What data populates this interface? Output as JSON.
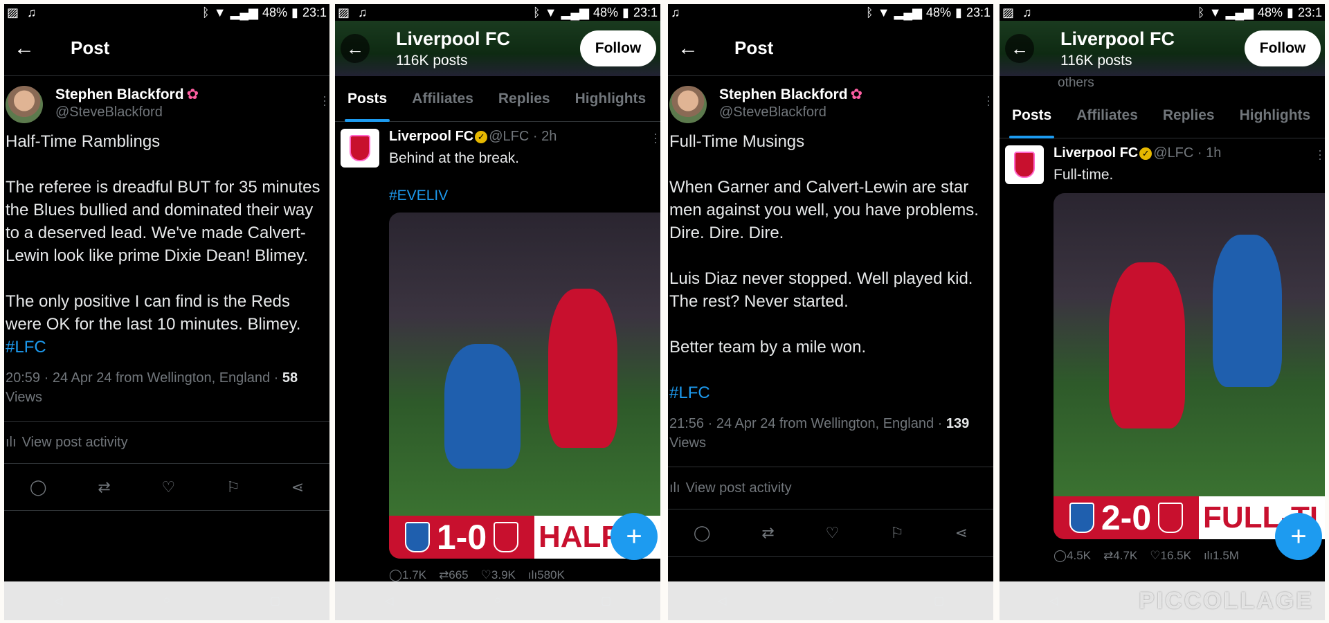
{
  "status": {
    "battery": "48%",
    "time": "23:1"
  },
  "post1": {
    "header_title": "Post",
    "author_name": "Stephen Blackford",
    "author_handle": "@SteveBlackford",
    "title_line": "Half-Time Ramblings",
    "para1": "The referee is dreadful BUT for 35 minutes the Blues bullied and dominated their way to a deserved lead. We've made Calvert-Lewin look like prime Dixie Dean! Blimey.",
    "para2": "The only positive I can find is the Reds were OK for the last 10 minutes. Blimey.",
    "hashtag": "#LFC",
    "meta": "20:59 · 24 Apr 24 from Wellington, England · ",
    "views_count": "58",
    "views_label": "Views",
    "activity_label": "View post activity"
  },
  "post2": {
    "header_title": "Post",
    "author_name": "Stephen Blackford",
    "author_handle": "@SteveBlackford",
    "title_line": "Full-Time Musings",
    "para1": "When Garner and Calvert-Lewin are star men against you well, you have problems. Dire. Dire. Dire.",
    "para2": "Luis Diaz never stopped. Well played kid. The rest? Never started.",
    "para3": "Better team by a mile won.",
    "hashtag": "#LFC",
    "meta": "21:56 · 24 Apr 24 from Wellington, England · ",
    "views_count": "139",
    "views_label": "Views",
    "activity_label": "View post activity"
  },
  "profile1": {
    "name": "Liverpool FC",
    "posts_count": "116K posts",
    "follow_label": "Follow",
    "tabs": [
      "Posts",
      "Affiliates",
      "Replies",
      "Highlights"
    ],
    "tweet_name": "Liverpool FC",
    "tweet_handle": "@LFC · 2h",
    "tweet_text": "Behind at the break.",
    "tweet_hashtag": "#EVELIV",
    "score": "1-0",
    "banner_text": "HALF-T",
    "stats": {
      "replies": "1.7K",
      "reposts": "665",
      "likes": "3.9K",
      "views": "580K"
    }
  },
  "profile2": {
    "name": "Liverpool FC",
    "posts_count": "116K posts",
    "follow_label": "Follow",
    "others_text": "others",
    "tabs": [
      "Posts",
      "Affiliates",
      "Replies",
      "Highlights"
    ],
    "tweet_name": "Liverpool FC",
    "tweet_handle": "@LFC · 1h",
    "tweet_text": "Full-time.",
    "score": "2-0",
    "banner_text": "FULL-TI",
    "stats": {
      "replies": "4.5K",
      "reposts": "4.7K",
      "likes": "16.5K",
      "views": "1.5M"
    }
  },
  "watermark": "PICCOLLAGE",
  "colors": {
    "accent": "#1d9bf0",
    "lfc_red": "#c8102e",
    "everton_blue": "#1f5fae"
  }
}
